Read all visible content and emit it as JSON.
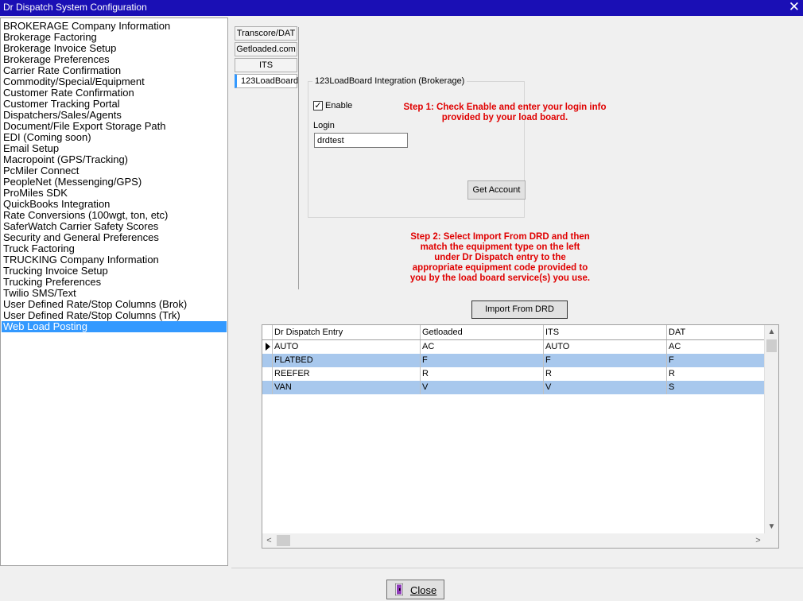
{
  "window": {
    "title": "Dr Dispatch  System Configuration",
    "close_icon": "close-icon"
  },
  "sidebar": {
    "items": [
      "BROKERAGE Company Information",
      "Brokerage Factoring",
      "Brokerage Invoice Setup",
      "Brokerage Preferences",
      "Carrier Rate Confirmation",
      "Commodity/Special/Equipment",
      "Customer Rate Confirmation",
      "Customer Tracking Portal",
      "Dispatchers/Sales/Agents",
      "Document/File Export Storage Path",
      "EDI (Coming soon)",
      "Email Setup",
      "Macropoint (GPS/Tracking)",
      "PcMiler Connect",
      "PeopleNet (Messenging/GPS)",
      "ProMiles SDK",
      "QuickBooks Integration",
      "Rate Conversions (100wgt, ton, etc)",
      "SaferWatch Carrier Safety Scores",
      "Security and General Preferences",
      "Truck Factoring",
      "TRUCKING Company Information",
      "Trucking Invoice Setup",
      "Trucking Preferences",
      "Twilio SMS/Text",
      "User Defined Rate/Stop Columns (Brok)",
      "User Defined Rate/Stop Columns (Trk)",
      "Web Load Posting"
    ],
    "selected": "Web Load Posting"
  },
  "tabs": [
    "Transcore/DAT",
    "Getloaded.com",
    "ITS",
    "123LoadBoard"
  ],
  "active_tab": "123LoadBoard",
  "integration": {
    "group_title": "123LoadBoard Integration (Brokerage)",
    "enable_label": "Enable",
    "enable_checked": true,
    "login_label": "Login",
    "login_value": "drdtest",
    "get_account_label": "Get Account"
  },
  "notes": {
    "step1_line1": "Step 1: Check Enable and enter your login info",
    "step1_line2": "provided by your load board.",
    "step2_line1": "Step 2: Select Import From DRD and then",
    "step2_line2": "match the equipment type on the left",
    "step2_line3": "under Dr Dispatch entry to the",
    "step2_line4": "appropriate equipment code provided to",
    "step2_line5": "you by the load board service(s) you use."
  },
  "import_button_label": "Import From DRD",
  "grid": {
    "columns": [
      "Dr Dispatch Entry",
      "Getloaded",
      "ITS",
      "DAT"
    ],
    "rows": [
      [
        "AUTO",
        "AC",
        "AUTO",
        "AC"
      ],
      [
        "FLATBED",
        "F",
        "F",
        "F"
      ],
      [
        "REEFER",
        "R",
        "R",
        "R"
      ],
      [
        "VAN",
        "V",
        "V",
        "S"
      ]
    ],
    "current_row": 0,
    "alt_color": "#a8c8ed"
  },
  "footer": {
    "close_label": "Close",
    "close_icon": "exit-door-icon"
  },
  "colors": {
    "titlebar": "#1a0fb5",
    "selection": "#3399ff",
    "note_red": "#e00000"
  }
}
